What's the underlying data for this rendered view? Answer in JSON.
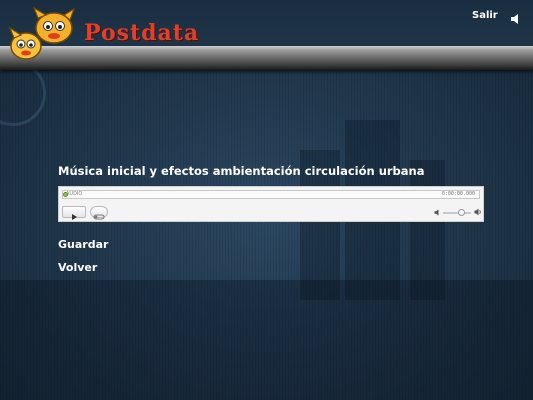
{
  "header": {
    "logo_text": "Postdata",
    "exit_label": "Salir",
    "sound_icon": "speaker-icon"
  },
  "content": {
    "track_title": "Música inicial y efectos ambientación circulación urbana"
  },
  "player": {
    "label": "AUDIO",
    "time": "0:00:00.000",
    "progress": 0,
    "volume": 0.7,
    "play_icon": "play-icon",
    "loop_icon": "loop-icon"
  },
  "actions": {
    "save_label": "Guardar",
    "back_label": "Volver"
  }
}
